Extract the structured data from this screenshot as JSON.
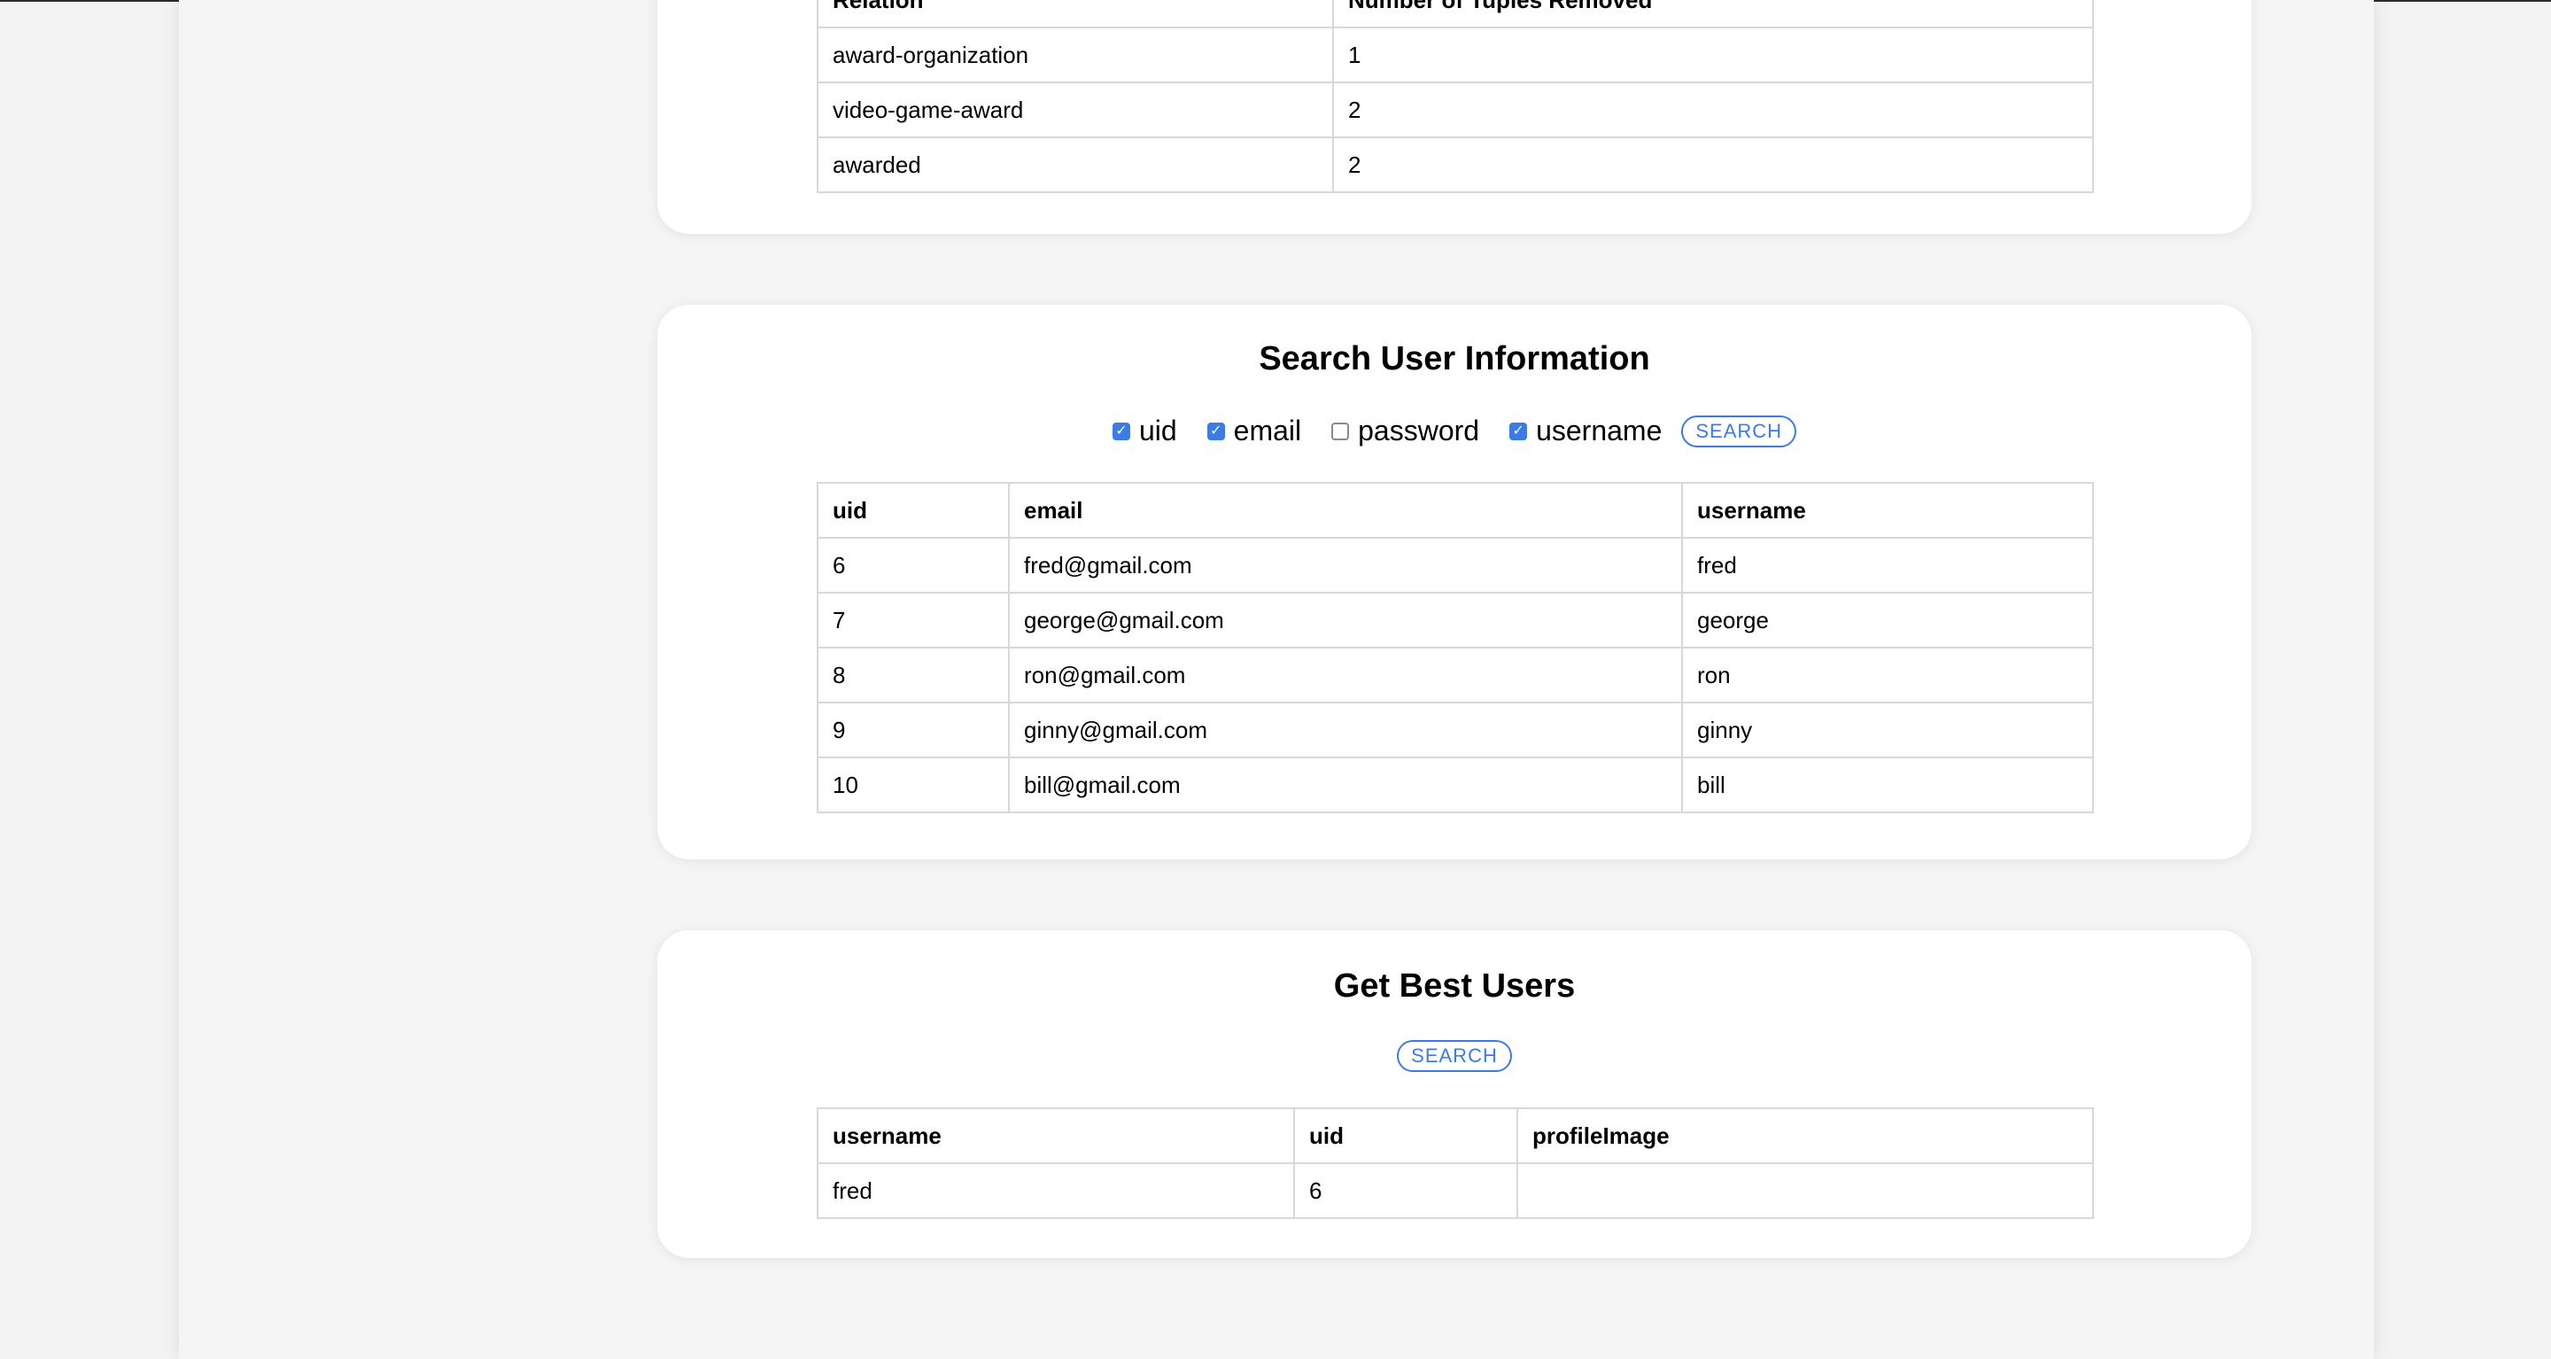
{
  "removed_relations": {
    "headers": [
      "Relation",
      "Number of Tuples Removed"
    ],
    "rows": [
      [
        "award-organization",
        "1"
      ],
      [
        "video-game-award",
        "2"
      ],
      [
        "awarded",
        "2"
      ]
    ]
  },
  "search_user": {
    "title": "Search User Information",
    "options": [
      {
        "label": "uid",
        "checked": true
      },
      {
        "label": "email",
        "checked": true
      },
      {
        "label": "password",
        "checked": false
      },
      {
        "label": "username",
        "checked": true
      }
    ],
    "search_label": "SEARCH",
    "headers": [
      "uid",
      "email",
      "username"
    ],
    "rows": [
      [
        "6",
        "fred@gmail.com",
        "fred"
      ],
      [
        "7",
        "george@gmail.com",
        "george"
      ],
      [
        "8",
        "ron@gmail.com",
        "ron"
      ],
      [
        "9",
        "ginny@gmail.com",
        "ginny"
      ],
      [
        "10",
        "bill@gmail.com",
        "bill"
      ]
    ]
  },
  "best_users": {
    "title": "Get Best Users",
    "search_label": "SEARCH",
    "headers": [
      "username",
      "uid",
      "profileImage"
    ],
    "rows": [
      [
        "fred",
        "6",
        ""
      ]
    ]
  },
  "colors": {
    "accent": "#3b7be8",
    "card_bg": "#ffffff",
    "page_bg": "#f5f5f5",
    "border": "#d8d8d8"
  }
}
